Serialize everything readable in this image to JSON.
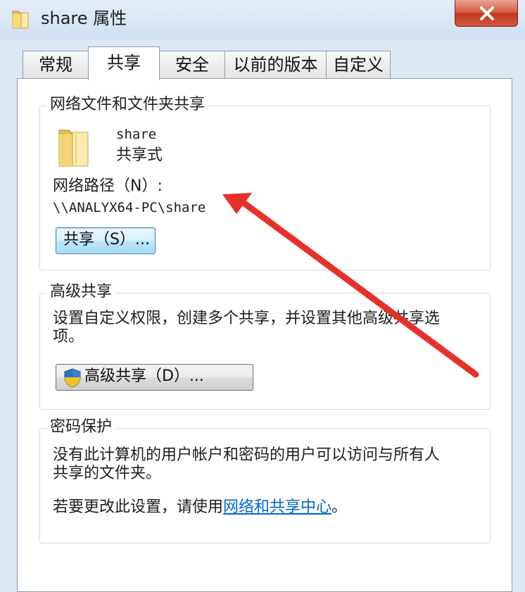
{
  "window": {
    "title": "share 属性",
    "title_icon": "folder-icon",
    "close_icon": "close-icon"
  },
  "tabs": [
    {
      "label": "常规",
      "active": false
    },
    {
      "label": "共享",
      "active": true
    },
    {
      "label": "安全",
      "active": false
    },
    {
      "label": "以前的版本",
      "active": false
    },
    {
      "label": "自定义",
      "active": false
    }
  ],
  "network_share": {
    "legend": "网络文件和文件夹共享",
    "folder_icon": "folder-icon",
    "folder_name": "share",
    "share_status": "共享式",
    "path_label": "网络路径（N）:",
    "path_value": "\\\\ANALYX64-PC\\share",
    "share_button": "共享（S）..."
  },
  "advanced_share": {
    "legend": "高级共享",
    "description_line1": "设置自定义权限，创建多个共享，并设置其他高级共享选",
    "description_line2": "项。",
    "shield_icon": "uac-shield-icon",
    "button": "高级共享（D）..."
  },
  "password_protect": {
    "legend": "密码保护",
    "description_line1": "没有此计算机的用户帐户和密码的用户可以访问与所有人",
    "description_line2": "共享的文件夹。",
    "change_prefix": "若要更改此设置，请使用",
    "change_link": "网络和共享中心",
    "change_suffix": "。"
  },
  "annotation": {
    "arrow_color": "#e8302a"
  }
}
